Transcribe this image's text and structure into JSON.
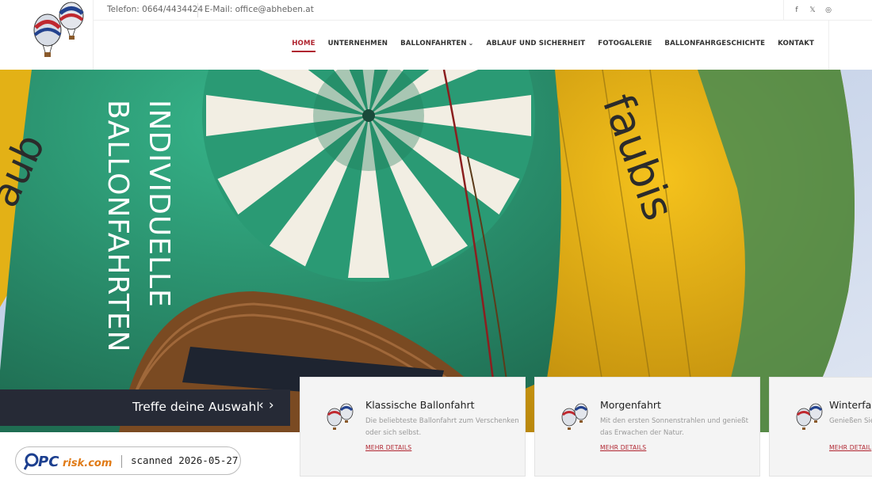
{
  "topbar": {
    "phone": "Telefon: 0664/4434424",
    "email": "E-Mail: office@abheben.at"
  },
  "socials": [
    "facebook-icon",
    "x-icon",
    "instagram-icon"
  ],
  "nav": {
    "items": [
      {
        "label": "HOME",
        "active": true
      },
      {
        "label": "UNTERNEHMEN"
      },
      {
        "label": "BALLONFAHRTEN",
        "has_dropdown": true
      },
      {
        "label": "ABLAUF UND SICHERHEIT"
      },
      {
        "label": "FOTOGALERIE"
      },
      {
        "label": "BALLONFAHRGESCHICHTE"
      },
      {
        "label": "KONTAKT"
      }
    ]
  },
  "hero": {
    "line1": "INDIVIDUELLE",
    "line2": "BALLONFAHRTEN"
  },
  "chooser": {
    "label": "Treffe deine Auswahl",
    "prev": "‹",
    "next": "›"
  },
  "cards": [
    {
      "title": "Klassische Ballonfahrt",
      "desc": "Die beliebteste Ballonfahrt zum Verschenken oder sich selbst.",
      "more": "MEHR DETAILS"
    },
    {
      "title": "Morgenfahrt",
      "desc": "Mit den ersten Sonnenstrahlen und genießt das Erwachen der Natur.",
      "more": "MEHR DETAILS"
    },
    {
      "title": "Winterfah",
      "desc": "Genießen Sie Alpenvorland",
      "more": "MEHR DETAIL"
    }
  ],
  "watermark": {
    "text": "scanned 2026-05-27",
    "brand": "PCrisk.com"
  },
  "colors": {
    "accent": "#b02530",
    "dark_bar": "#262a36",
    "card_bg": "#f4f4f4"
  }
}
